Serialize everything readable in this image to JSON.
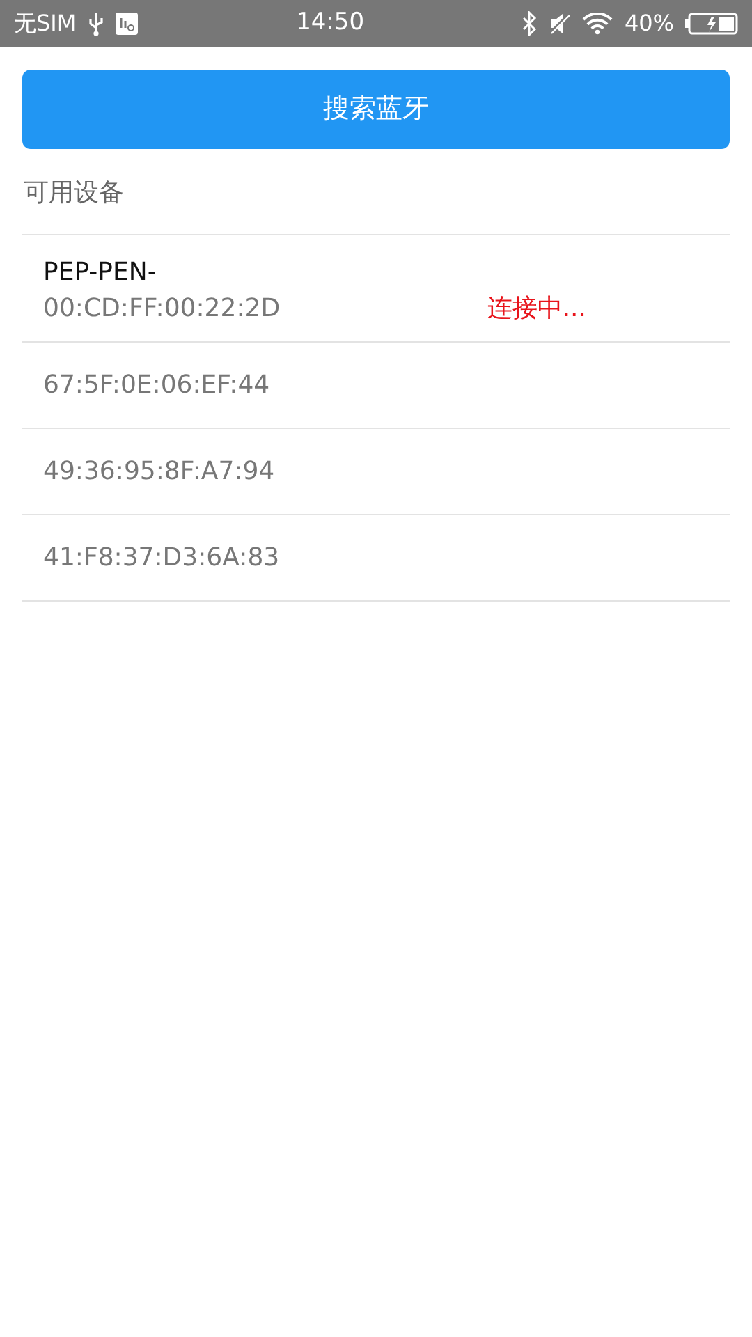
{
  "status_bar": {
    "carrier": "无SIM",
    "time": "14:50",
    "battery_text": "40%"
  },
  "search_button": "搜索蓝牙",
  "section_title": "可用设备",
  "devices": [
    {
      "name": "PEP-PEN-",
      "address": "00:CD:FF:00:22:2D",
      "status": "连接中..."
    },
    {
      "address": "67:5F:0E:06:EF:44"
    },
    {
      "address": "49:36:95:8F:A7:94"
    },
    {
      "address": "41:F8:37:D3:6A:83"
    }
  ]
}
